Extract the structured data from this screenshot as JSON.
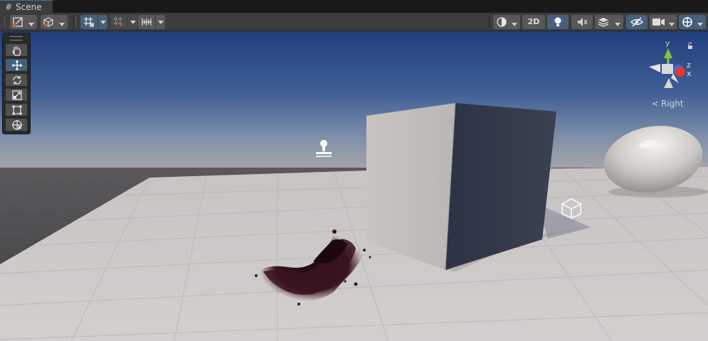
{
  "tab": {
    "icon": "grid-hash-icon",
    "label": "Scene"
  },
  "toolbar": {
    "left_buttons": [
      "draw-mode-icon",
      "scene-camera-icon"
    ],
    "snap_buttons": [
      "grid-snap-icon",
      "grid-visibility-icon",
      "increment-snap-icon"
    ],
    "shading_icon": "shading-mode-icon",
    "mode_2d_label": "2D",
    "right_buttons": [
      "lighting-icon",
      "audio-icon",
      "effects-icon",
      "hidden-objects-icon",
      "camera-settings-icon",
      "gizmos-icon"
    ]
  },
  "tools": [
    "view-hand-tool",
    "move-tool",
    "rotate-tool",
    "scale-tool",
    "rect-tool",
    "transform-tool"
  ],
  "gizmo": {
    "y": "y",
    "z": "z",
    "x": "x",
    "view_label": "Right",
    "back_arrow": "<"
  },
  "colors": {
    "sky_top": "#2a4a85",
    "horizon": "#a2a4a8",
    "floor": "#cfcbca",
    "active": "#46607c",
    "axis_x": "#e43a2e",
    "axis_y": "#86c440",
    "axis_z": "#3a6ed8"
  }
}
